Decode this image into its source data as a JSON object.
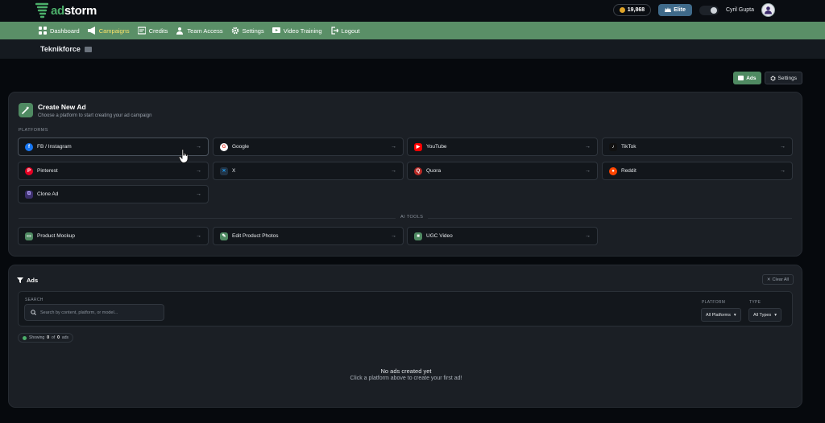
{
  "brand": {
    "prefix": "ad",
    "suffix": "storm"
  },
  "top": {
    "credits": "19,868",
    "plan": "Elite",
    "user": "Cyril Gupta"
  },
  "nav": [
    {
      "label": "Dashboard",
      "icon": "dashboard-icon"
    },
    {
      "label": "Campaigns",
      "icon": "megaphone-icon",
      "active": true
    },
    {
      "label": "Credits",
      "icon": "credits-icon"
    },
    {
      "label": "Team Access",
      "icon": "team-icon"
    },
    {
      "label": "Settings",
      "icon": "gear-icon"
    },
    {
      "label": "Video Training",
      "icon": "video-icon"
    },
    {
      "label": "Logout",
      "icon": "logout-icon"
    }
  ],
  "org": {
    "name": "Teknikforce"
  },
  "actions": {
    "ads": "Ads",
    "settings": "Settings"
  },
  "create": {
    "title": "Create New Ad",
    "subtitle": "Choose a platform to start creating your ad campaign",
    "platforms_label": "PLATFORMS",
    "platforms": [
      {
        "label": "FB / Instagram",
        "icon": "facebook-icon",
        "color": "#1877f2"
      },
      {
        "label": "Google",
        "icon": "google-icon",
        "color": "#ea4335"
      },
      {
        "label": "YouTube",
        "icon": "youtube-icon",
        "color": "#ff0000"
      },
      {
        "label": "TikTok",
        "icon": "tiktok-icon",
        "color": "#111111"
      },
      {
        "label": "Pinterest",
        "icon": "pinterest-icon",
        "color": "#e60023"
      },
      {
        "label": "X",
        "icon": "x-icon",
        "color": "#1d9bf0"
      },
      {
        "label": "Quora",
        "icon": "quora-icon",
        "color": "#b92b27"
      },
      {
        "label": "Reddit",
        "icon": "reddit-icon",
        "color": "#ff4500"
      },
      {
        "label": "Clone Ad",
        "icon": "clone-icon",
        "color": "#7b5cff"
      }
    ],
    "ai_label": "AI TOOLS",
    "ai_tools": [
      {
        "label": "Product Mockup",
        "icon": "mockup-icon"
      },
      {
        "label": "Edit Product Photos",
        "icon": "edit-photo-icon"
      },
      {
        "label": "UGC Video",
        "icon": "ugc-video-icon"
      }
    ]
  },
  "ads": {
    "title": "Ads",
    "clear": "Clear All",
    "search_label": "SEARCH",
    "search_placeholder": "Search by content, platform, or model...",
    "platform_label": "PLATFORM",
    "platform_value": "All Platforms",
    "type_label": "TYPE",
    "type_value": "All Types",
    "showing_prefix": "Showing",
    "showing_count": "0",
    "showing_of": "of",
    "showing_total": "0",
    "showing_suffix": "ads",
    "empty_title": "No ads created yet",
    "empty_sub": "Click a platform above to create your first ad!"
  }
}
